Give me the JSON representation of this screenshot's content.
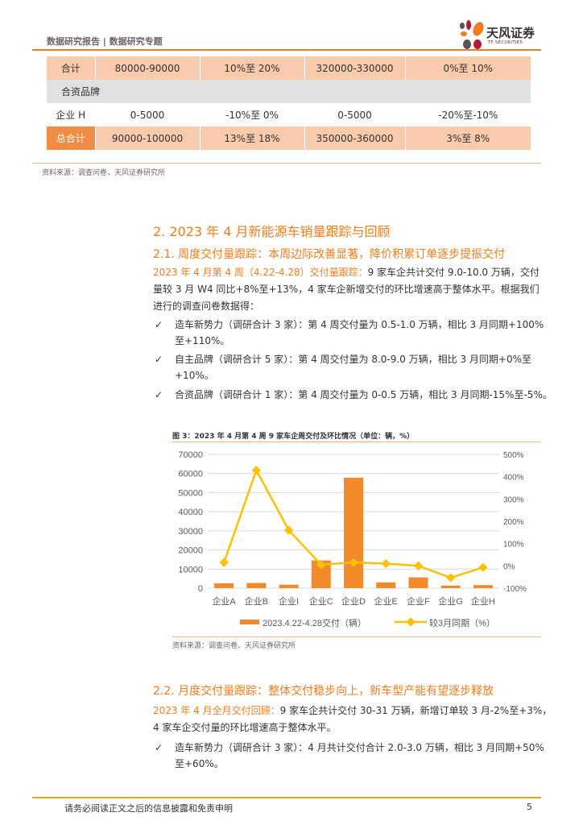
{
  "header": {
    "title": "数据研究报告 | 数据研究专题",
    "logo_name": "天风证券",
    "logo_sub": "TF SECURITIES"
  },
  "table": {
    "rows": [
      {
        "cells": [
          "合计",
          "80000-90000",
          "10%至 20%",
          "320000-330000",
          "0%至 10%"
        ]
      },
      {
        "cells": [
          "合资品牌",
          "",
          "",
          "",
          ""
        ]
      },
      {
        "cells": [
          "企业 H",
          "0-5000",
          "-10%至 0%",
          "0-5000",
          "-20%至-10%"
        ]
      },
      {
        "cells": [
          "总合计",
          "90000-100000",
          "13%至 18%",
          "350000-360000",
          "3%至 8%"
        ]
      }
    ],
    "source": "资料来源：调查问卷，天风证券研究所"
  },
  "section2": {
    "title": "2. 2023 年 4 月新能源车销量跟踪与回顾"
  },
  "s21": {
    "title": "2.1. 周度交付量跟踪：本周边际改善显著，降价积累订单逐步提振交付",
    "lead": "2023 年 4 月第 4 周（4.22-4.28）交付量跟踪：",
    "line1": "9 家车企共计交付 9.0-10.0 万辆，交付",
    "line2": "量较 3 月 W4 同比+8%至+13%，4 家车企新增交付的环比增速高于整体水平。根据我们",
    "line3": "进行的调查问卷数据得：",
    "bullets": [
      {
        "check": "✓",
        "lines": [
          "造车新势力（调研合计 3 家）：第 4 周交付量为 0.5-1.0 万辆，相比 3 月同期+100%",
          "至+110%。"
        ]
      },
      {
        "check": "✓",
        "lines": [
          "自主品牌（调研合计 5 家）：第 4 周交付量为 8.0-9.0 万辆，相比 3 月同期+0%至",
          "+10%。"
        ]
      },
      {
        "check": "✓",
        "lines": [
          "合资品牌（调研合计 1 家）：第 4 周交付量为 0-0.5 万辆，相比 3 月同期-15%至-5%。"
        ]
      }
    ]
  },
  "figure": {
    "title": "图 3：2023 年 4 月第 4 周 9 家车企周交付及环比情况（单位：辆，%）",
    "source": "资料来源：调查问卷、天风证券研究所"
  },
  "chart_data": {
    "type": "bar+line",
    "title": "图 3：2023 年 4 月第 4 周 9 家车企周交付及环比情况（单位：辆，%）",
    "categories": [
      "企业A",
      "企业B",
      "企业I",
      "企业C",
      "企业D",
      "企业E",
      "企业F",
      "企业G",
      "企业H"
    ],
    "series": [
      {
        "name": "2023.4.22-4.28交付（辆）",
        "type": "bar",
        "axis": "left",
        "color": "#f28a2b",
        "values": [
          2500,
          2700,
          1800,
          14500,
          57800,
          3000,
          5600,
          1300,
          1600
        ]
      },
      {
        "name": "较3月同期（%）",
        "type": "line",
        "axis": "right",
        "color": "#ffc000",
        "values": [
          15,
          429,
          160,
          5,
          15,
          10,
          0,
          -53,
          -7
        ]
      }
    ],
    "left_axis": {
      "ylim": [
        0,
        70000
      ],
      "ticks": [
        "0",
        "10000",
        "20000",
        "30000",
        "40000",
        "50000",
        "60000",
        "70000"
      ]
    },
    "right_axis": {
      "ylim": [
        -100,
        500
      ],
      "ticks": [
        "-100%",
        "0%",
        "100%",
        "200%",
        "300%",
        "400%",
        "500%"
      ]
    },
    "grid": true,
    "legend": "bottom"
  },
  "s22": {
    "title": "2.2. 月度交付量跟踪：整体交付稳步向上，新车型产能有望逐步释放",
    "lead": "2023 年 4 月全月交付回顾：",
    "line1": "9 家车企共计交付 30-31 万辆，新增订单较 3 月-2%至+3%，",
    "line2": "4 家车企交付量的环比增速高于整体水平。",
    "bullets": [
      {
        "check": "✓",
        "lines": [
          "造车新势力（调研合计 3 家）：4 月共计交付合计 2.0-3.0 万辆，相比 3 月同期+50%",
          "至+60%。"
        ]
      }
    ]
  },
  "footer": {
    "disclaimer": "请务必阅读正文之后的信息披露和免责申明",
    "page": "5"
  }
}
